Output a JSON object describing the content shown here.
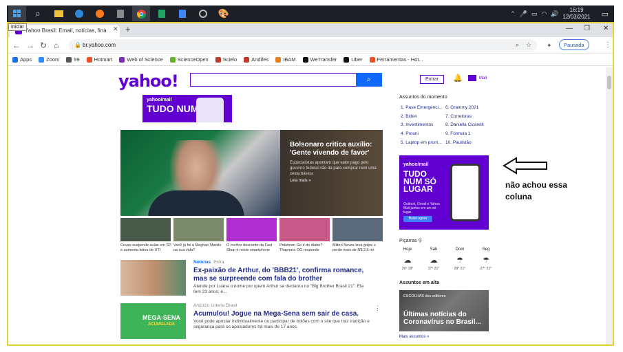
{
  "taskbar": {
    "tooltip": "Iniciar",
    "clock_time": "16:19",
    "clock_date": "12/03/2021"
  },
  "browser": {
    "tab_title": "Yahoo Brasil: Email, notícias, fina",
    "url": "br.yahoo.com",
    "profile_status": "Pausada",
    "bookmarks": [
      {
        "label": "Apps",
        "color": "#1a73e8"
      },
      {
        "label": "Zoom",
        "color": "#2d8cff"
      },
      {
        "label": "99",
        "color": "#555555"
      },
      {
        "label": "Hotmart",
        "color": "#f04e23"
      },
      {
        "label": "Web of Science",
        "color": "#7b2fbe"
      },
      {
        "label": "ScienceOpen",
        "color": "#67b32e"
      },
      {
        "label": "Scielo",
        "color": "#c0392b"
      },
      {
        "label": "Andifes",
        "color": "#c0392b"
      },
      {
        "label": "IBAM",
        "color": "#e67e22"
      },
      {
        "label": "WeTransfer",
        "color": "#111111"
      },
      {
        "label": "Uber",
        "color": "#111111"
      },
      {
        "label": "Ferramentas - Hot...",
        "color": "#f04e23"
      }
    ]
  },
  "yahoo": {
    "logo": "yahoo!",
    "signin": "Entrar",
    "mail": "Mail",
    "top_ad": {
      "brand": "yahoo/mail",
      "headline": "TUDO NUM SÓ"
    },
    "hero": {
      "title": "Bolsonaro critica auxílio: 'Gente vivendo de favor'",
      "desc": "Especialistas apontam que valor pago pelo governo federal não dá para comprar nem uma cesta básica",
      "more": "Leia mais »"
    },
    "thumbs": [
      {
        "caption": "Covas suspende aulas em SP e aumenta leitos de UTI",
        "color": "#4a5a4a"
      },
      {
        "caption": "Você já foi a Meghan Markle na sua vida?",
        "color": "#7a8a6a"
      },
      {
        "caption": "O melhor desconto da Fast Shop é neste smartphone",
        "color": "#b02fd0"
      },
      {
        "caption": "Pokémon Go é do diabo? Thaynara OG responde",
        "color": "#c85a8a"
      },
      {
        "caption": "Milton Neves leva golpe e perde mais de R$ 2,5 mi",
        "color": "#5a6a7a"
      }
    ],
    "stories": [
      {
        "source": "Notícias",
        "provider": "Extra",
        "title": "Ex-paixão de Arthur, do 'BBB21', confirma romance, mas se surpreende com fala do brother",
        "desc": "Atende por Luana o nome por quem Arthur se declarou no \"Big Brother Brasil 21\". Ela tem 23 anos, é..."
      },
      {
        "source": "Anúncio",
        "provider": "Loteria Brasil",
        "title": "Acumulou! Jogue na Mega-Sena sem sair de casa.",
        "desc": "Você pode apostar individualmente ou participar de bolões com o site que traz tradição e segurança para os apostadores há mais de 17 anos.",
        "image_text": "MEGA-SENA",
        "image_sub": "ACUMULADA"
      }
    ],
    "trending": {
      "heading": "Assuntos do momento",
      "items": [
        "1. Pase Emergenci...",
        "2. Biden",
        "3. Investimentos",
        "4. Prouni",
        "5. Laptop em prom...",
        "6. Grammy 2021",
        "7. Corretoras",
        "8. Daniella Cicarelli",
        "9. Fórmula 1",
        "10. Paulistão"
      ]
    },
    "right_ad": {
      "brand": "yahoo/mail",
      "headline": "TUDO NUM SÓ LUGAR",
      "sub": "Outlook, Gmail e Yahoo Mail juntos em um só lugar.",
      "cta": "Baixe agora"
    },
    "weather": {
      "location": "Piçarras",
      "days": [
        {
          "day": "Hoje",
          "icon": "☁",
          "temp": "26° 19°"
        },
        {
          "day": "Sáb",
          "icon": "☁",
          "temp": "27° 21°"
        },
        {
          "day": "Dom",
          "icon": "☂",
          "temp": "29° 21°"
        },
        {
          "day": "Seg",
          "icon": "☂",
          "temp": "27° 21°"
        }
      ]
    },
    "alta": {
      "heading": "Assuntos em alta",
      "label": "ESCOLHAS dos editores",
      "title": "Últimas notícias do Coronavírus no Brasil...",
      "more": "Mais assuntos »"
    }
  },
  "annotation": "não achou essa coluna"
}
